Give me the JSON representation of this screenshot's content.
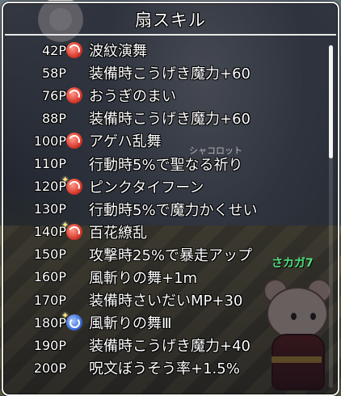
{
  "window": {
    "title": "扇スキル"
  },
  "scene": {
    "name_tag": "シャコロット",
    "green_name": "さカガ7"
  },
  "skills": [
    {
      "points": "42P",
      "icon": "red-skill-icon",
      "new": false,
      "label": "波紋演舞"
    },
    {
      "points": "58P",
      "icon": "",
      "new": false,
      "label": "装備時こうげき魔力+60"
    },
    {
      "points": "76P",
      "icon": "red-skill-icon",
      "new": false,
      "label": "おうぎのまい"
    },
    {
      "points": "88P",
      "icon": "",
      "new": false,
      "label": "装備時こうげき魔力+60"
    },
    {
      "points": "100P",
      "icon": "red-skill-icon",
      "new": false,
      "label": "アゲハ乱舞"
    },
    {
      "points": "110P",
      "icon": "",
      "new": false,
      "label": "行動時5%で聖なる祈り"
    },
    {
      "points": "120P",
      "icon": "red-skill-icon",
      "new": true,
      "label": "ピンクタイフーン"
    },
    {
      "points": "130P",
      "icon": "",
      "new": false,
      "label": "行動時5%で魔力かくせい"
    },
    {
      "points": "140P",
      "icon": "red-skill-icon",
      "new": true,
      "label": "百花繚乱"
    },
    {
      "points": "150P",
      "icon": "",
      "new": false,
      "label": "攻撃時25%で暴走アップ"
    },
    {
      "points": "160P",
      "icon": "",
      "new": false,
      "label": "風斬りの舞+1m"
    },
    {
      "points": "170P",
      "icon": "",
      "new": false,
      "label": "装備時さいだいMP+30"
    },
    {
      "points": "180P",
      "icon": "blue-skill-icon",
      "new": true,
      "label": "風斬りの舞Ⅲ"
    },
    {
      "points": "190P",
      "icon": "",
      "new": false,
      "label": "装備時こうげき魔力+40"
    },
    {
      "points": "200P",
      "icon": "",
      "new": false,
      "label": "呪文ぼうそう率+1.5%"
    }
  ],
  "scroll": {
    "position_fraction": 0.0,
    "visible_fraction": 0.33
  }
}
